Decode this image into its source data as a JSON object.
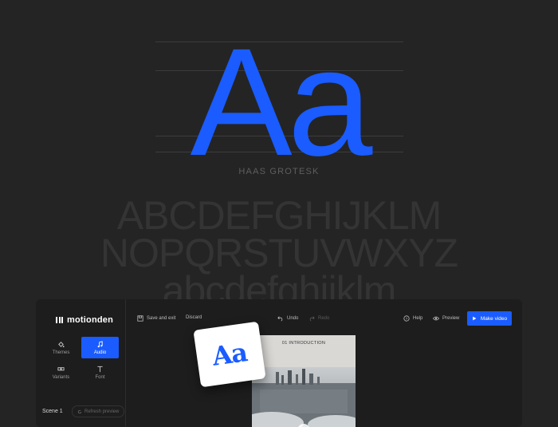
{
  "specimen": {
    "glyphs": "Aa",
    "font_name": "HAAS GROTESK",
    "uppercase_1": "ABCDEFGHIJKLM",
    "uppercase_2": "NOPQRSTUVWXYZ",
    "lowercase": "abcdefghijklm"
  },
  "app": {
    "logo_text": "motionden",
    "sidebar": {
      "tools": [
        {
          "label": "Themes",
          "icon": "paint-bucket-icon"
        },
        {
          "label": "Audio",
          "icon": "music-note-icon",
          "active": true
        },
        {
          "label": "Variants",
          "icon": "variants-icon"
        },
        {
          "label": "Font",
          "icon": "text-icon"
        }
      ],
      "scene_label": "Scene 1",
      "refresh_label": "Refresh preview"
    },
    "toolbar": {
      "save_label": "Save and exit",
      "discard_label": "Discard",
      "undo_label": "Undo",
      "redo_label": "Redo",
      "help_label": "Help",
      "preview_label": "Preview",
      "make_video_label": "Make video"
    },
    "preview_card": {
      "title": "01   INTRODUCTION"
    },
    "tile_text": "Aa"
  },
  "colors": {
    "background": "#242424",
    "accent": "#1a5cff",
    "panel": "#1d1d1d"
  }
}
